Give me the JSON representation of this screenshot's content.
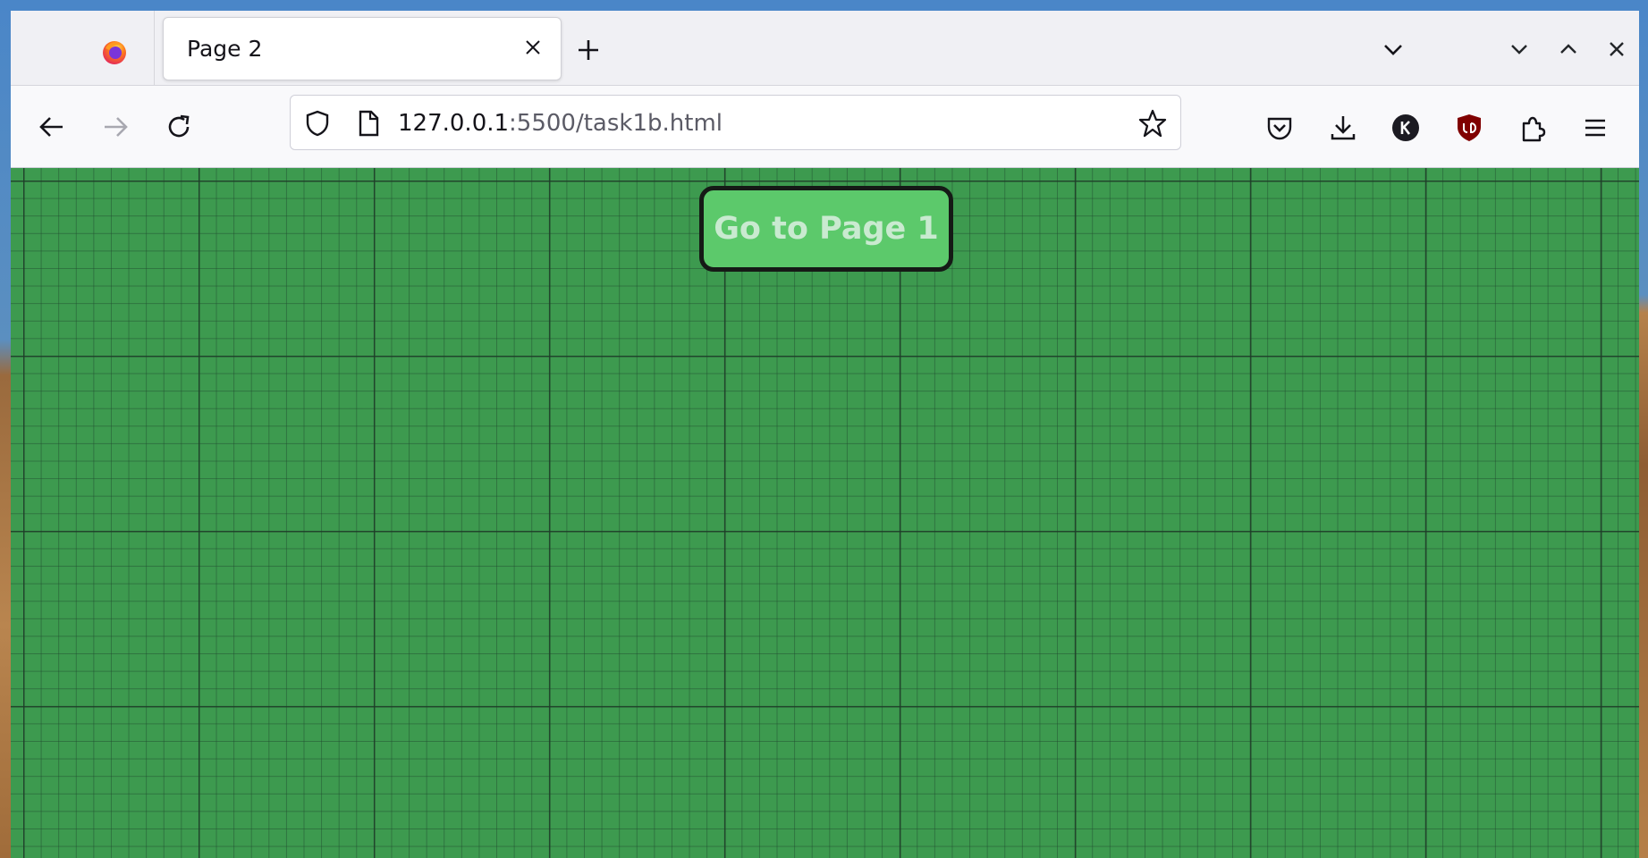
{
  "browser": {
    "tab": {
      "title": "Page 2"
    },
    "url": {
      "host": "127.0.0.1",
      "rest": ":5500/task1b.html"
    }
  },
  "page": {
    "button_label": "Go to Page 1",
    "background_color": "#3d9a4f",
    "button_color": "#5cc96b"
  }
}
